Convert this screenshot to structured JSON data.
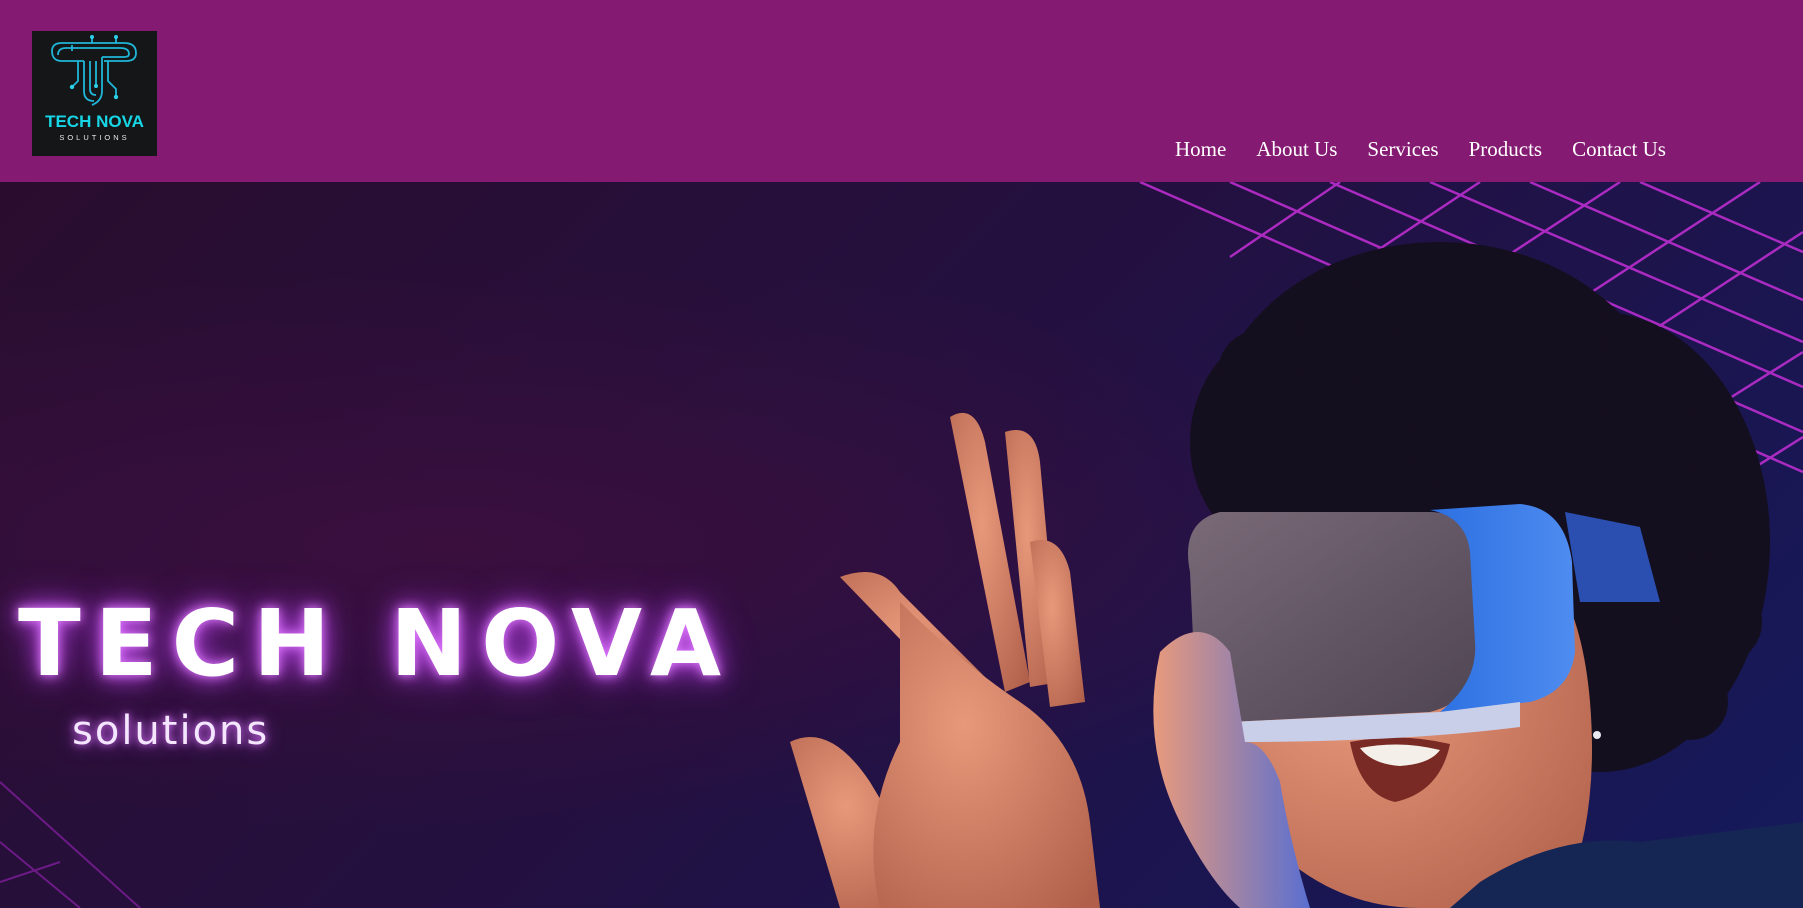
{
  "brand": {
    "logo_title": "TECH NOVA",
    "logo_subtitle": "SOLUTIONS"
  },
  "nav": {
    "items": [
      {
        "label": "Home"
      },
      {
        "label": "About Us"
      },
      {
        "label": "Services"
      },
      {
        "label": "Products"
      },
      {
        "label": "Contact Us"
      }
    ]
  },
  "hero": {
    "title": "TECH NOVA",
    "subtitle": "solutions"
  },
  "colors": {
    "header_bg": "#841a72",
    "logo_accent": "#17d6e6",
    "glow": "#c04fe8"
  },
  "icons": {
    "logo_mark": "circuit-t-icon"
  }
}
